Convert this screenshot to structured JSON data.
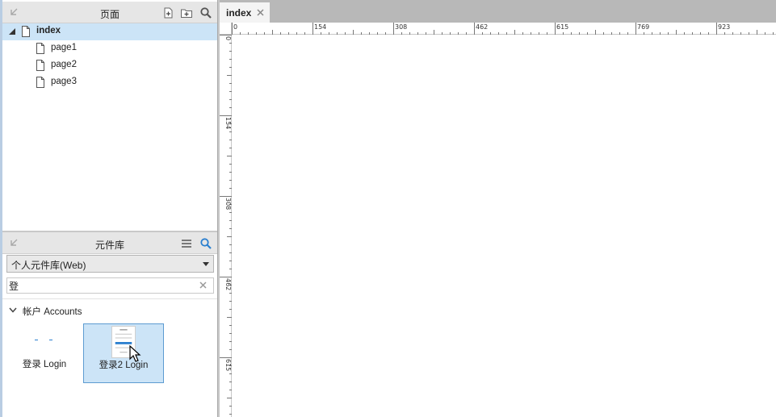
{
  "pages_panel": {
    "title": "页面",
    "icons": [
      "collapse-icon",
      "add-page-icon",
      "add-folder-icon",
      "search-icon"
    ],
    "tree": [
      {
        "label": "index",
        "selected": true,
        "expanded": true
      },
      {
        "label": "page1",
        "selected": false
      },
      {
        "label": "page2",
        "selected": false
      },
      {
        "label": "page3",
        "selected": false
      }
    ]
  },
  "library_panel": {
    "title": "元件库",
    "icons": [
      "collapse-icon",
      "menu-icon",
      "search-icon"
    ],
    "selected_library": "个人元件库(Web)",
    "search_value": "登",
    "group": {
      "label": "帐户 Accounts",
      "expanded": true
    },
    "widgets": [
      {
        "label": "登录 Login",
        "selected": false
      },
      {
        "label": "登录2 Login",
        "selected": true
      }
    ]
  },
  "editor": {
    "tabs": [
      {
        "label": "index",
        "active": true
      }
    ],
    "ruler": {
      "h_ticks": [
        "0",
        "154",
        "308",
        "462",
        "615",
        "769",
        "923"
      ],
      "v_ticks": [
        "0",
        "154",
        "308",
        "462",
        "615"
      ]
    }
  },
  "colors": {
    "selection": "#cce4f7",
    "accent": "#2a7fcf",
    "header_bg": "#e6e6e6",
    "tab_strip": "#b8b8b8"
  }
}
